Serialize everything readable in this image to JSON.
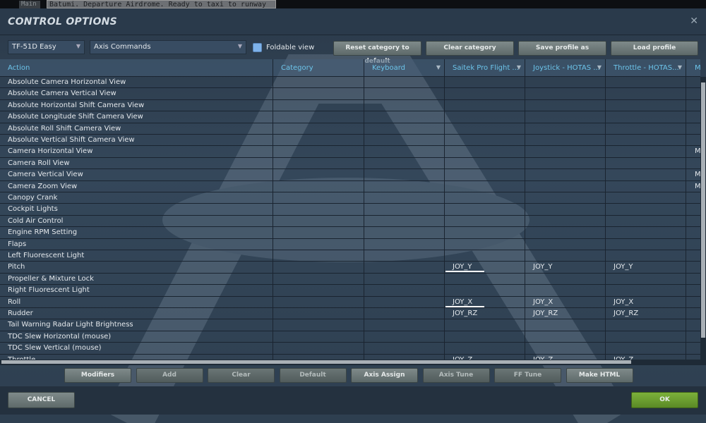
{
  "topbar": {
    "tab": "Main",
    "message": "Batumi. Departure Airdrome. Ready to taxi to runway"
  },
  "window": {
    "title": "CONTROL OPTIONS",
    "close": "✕"
  },
  "toolbar": {
    "aircraft": "TF-51D Easy",
    "category_filter": "Axis Commands",
    "foldable_label": "Foldable view",
    "foldable_checked": true,
    "buttons": [
      "Reset category to default",
      "Clear category",
      "Save profile as",
      "Load profile"
    ]
  },
  "columns": [
    "Action",
    "Category",
    "Keyboard",
    "Saitek Pro Flight ...",
    "Joystick - HOTAS ...",
    "Throttle - HOTAS...",
    "M"
  ],
  "rows": [
    {
      "action": "Absolute Camera Horizontal View"
    },
    {
      "action": "Absolute Camera Vertical View"
    },
    {
      "action": "Absolute Horizontal Shift Camera View"
    },
    {
      "action": "Absolute Longitude Shift Camera View"
    },
    {
      "action": "Absolute Roll Shift Camera View"
    },
    {
      "action": "Absolute Vertical Shift Camera View"
    },
    {
      "action": "Camera Horizontal View",
      "m": "M"
    },
    {
      "action": "Camera Roll View"
    },
    {
      "action": "Camera Vertical View",
      "m": "M"
    },
    {
      "action": "Camera Zoom View",
      "m": "M"
    },
    {
      "action": "Canopy Crank"
    },
    {
      "action": "Cockpit Lights"
    },
    {
      "action": "Cold Air Control"
    },
    {
      "action": "Engine RPM Setting"
    },
    {
      "action": "Flaps"
    },
    {
      "action": "Left Fluorescent Light"
    },
    {
      "action": "Pitch",
      "saitek": "JOY_Y",
      "joystick": "JOY_Y",
      "throttle": "JOY_Y",
      "modified": true
    },
    {
      "action": "Propeller & Mixture Lock"
    },
    {
      "action": "Right Fluorescent Light"
    },
    {
      "action": "Roll",
      "saitek": "JOY_X",
      "joystick": "JOY_X",
      "throttle": "JOY_X",
      "modified": true
    },
    {
      "action": "Rudder",
      "saitek": "JOY_RZ",
      "joystick": "JOY_RZ",
      "throttle": "JOY_RZ"
    },
    {
      "action": "Tail Warning Radar Light Brightness"
    },
    {
      "action": "TDC Slew Horizontal (mouse)"
    },
    {
      "action": "TDC Slew Vertical (mouse)"
    },
    {
      "action": "Throttle",
      "saitek": "JOY_Z",
      "joystick": "JOY_Z",
      "throttle": "JOY_Z"
    }
  ],
  "bottom_buttons": [
    {
      "label": "Modifiers",
      "enabled": true
    },
    {
      "label": "Add",
      "enabled": false
    },
    {
      "label": "Clear",
      "enabled": false
    },
    {
      "label": "Default",
      "enabled": false
    },
    {
      "label": "Axis Assign",
      "enabled": true
    },
    {
      "label": "Axis Tune",
      "enabled": false
    },
    {
      "label": "FF Tune",
      "enabled": false
    },
    {
      "label": "Make HTML",
      "enabled": true
    }
  ],
  "footer": {
    "cancel": "CANCEL",
    "ok": "OK"
  }
}
